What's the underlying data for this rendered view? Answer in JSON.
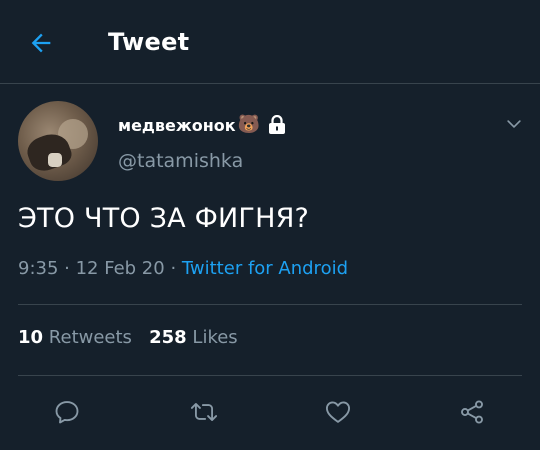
{
  "header": {
    "title": "Tweet",
    "back_icon": "arrow-left-icon"
  },
  "tweet": {
    "display_name": "медвежонок",
    "name_emoji": "🐻",
    "protected_icon": "lock-icon",
    "handle": "@tatamishka",
    "text": "ЭТО ЧТО ЗА ФИГНЯ?",
    "time": "9:35",
    "sep1": " · ",
    "date": "12 Feb 20",
    "sep2": " · ",
    "source": "Twitter for Android",
    "retweets_count": "10",
    "retweets_label": "Retweets",
    "likes_count": "258",
    "likes_label": "Likes"
  },
  "actions": [
    "reply-icon",
    "retweet-icon",
    "like-icon",
    "share-icon"
  ],
  "colors": {
    "background": "#15202b",
    "accent": "#1da1f2",
    "secondary_text": "#8899a6",
    "divider": "#38444d"
  }
}
